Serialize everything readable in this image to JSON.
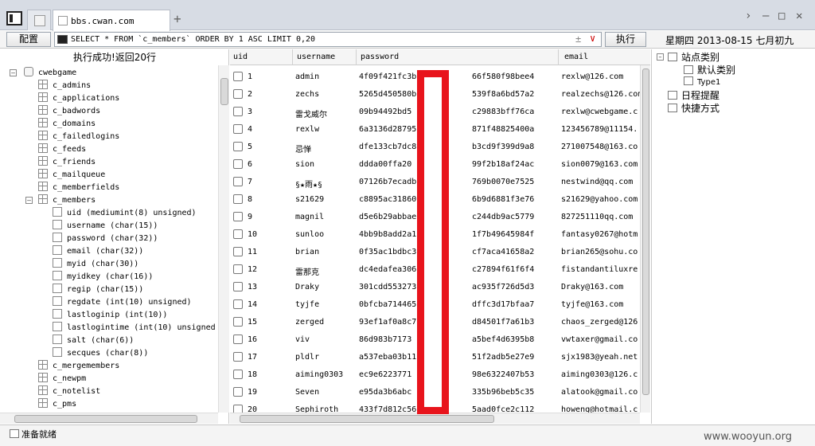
{
  "tab": {
    "title": "bbs.cwan.com",
    "add": "+"
  },
  "window": {
    "nav": "›",
    "minimize": "–",
    "maximize": "□",
    "close": "✕"
  },
  "toolbar": {
    "config_label": "配置",
    "sql_query": "SELECT * FROM `c_members` ORDER BY 1 ASC LIMIT 0,20",
    "plusminus": "±",
    "dropdown": "∨",
    "execute_label": "执行",
    "date": "星期四 2013-08-15 七月初九"
  },
  "result_message": "执行成功!返回20行",
  "tree": {
    "database": "cwebgame",
    "tables_before": [
      "c_admins",
      "c_applications",
      "c_badwords",
      "c_domains",
      "c_failedlogins",
      "c_feeds",
      "c_friends",
      "c_mailqueue",
      "c_memberfields"
    ],
    "expanded_table": "c_members",
    "columns": [
      "uid (mediumint(8) unsigned)",
      "username (char(15))",
      "password (char(32))",
      "email (char(32))",
      "myid (char(30))",
      "myidkey (char(16))",
      "regip (char(15))",
      "regdate (int(10) unsigned)",
      "lastloginip (int(10))",
      "lastlogintime (int(10) unsigned",
      "salt (char(6))",
      "secques (char(8))"
    ],
    "tables_after": [
      "c_mergemembers",
      "c_newpm",
      "c_notelist",
      "c_pms"
    ]
  },
  "grid": {
    "headers": [
      "uid",
      "username",
      "password",
      "email"
    ],
    "rows": [
      [
        "1",
        "admin",
        "4f09f421fc3b",
        "66f580f98bee4",
        "rexlw@126.com"
      ],
      [
        "2",
        "zechs",
        "5265d450580b",
        "539f8a6bd57a2",
        "realzechs@126.com"
      ],
      [
        "3",
        "雷戈威尔",
        "09b94492bd5",
        "c29883bff76ca",
        "rexlw@cwebgame.c"
      ],
      [
        "4",
        "rexlw",
        "6a3136d28795",
        "871f48825400a",
        "123456789@11154."
      ],
      [
        "5",
        "忌惮",
        "dfe133cb7dc8",
        "b3cd9f399d9a8",
        "271007548@163.co"
      ],
      [
        "6",
        "sion",
        "ddda00ffa20",
        "99f2b18af24ac",
        "sion0079@163.com"
      ],
      [
        "7",
        "§★雨★§",
        "07126b7ecadb",
        "769b0070e7525",
        "nestwind@qq.com"
      ],
      [
        "8",
        "s21629",
        "c8895ac31860",
        "6b9d6881f3e76",
        "s21629@yahoo.com"
      ],
      [
        "9",
        "magnil",
        "d5e6b29abbae",
        "c244db9ac5779",
        "827251110qq.com"
      ],
      [
        "10",
        "sunloo",
        "4bb9b8add2a1",
        "1f7b49645984f",
        "fantasy0267@hotm"
      ],
      [
        "11",
        "brian",
        "0f35ac1bdbc3",
        "cf7aca41658a2",
        "brian265@sohu.co"
      ],
      [
        "12",
        "雷那克",
        "dc4edafea306",
        "c27894f61f6f4",
        "fistandantiluxre"
      ],
      [
        "13",
        "Draky",
        "301cdd553273",
        "ac935f726d5d3",
        "Draky@163.com"
      ],
      [
        "14",
        "tyjfe",
        "0bfcba714465",
        "dffc3d17bfaa7",
        "tyjfe@163.com"
      ],
      [
        "15",
        "zerged",
        "93ef1af0a8c7",
        "d84501f7a61b3",
        "chaos_zerged@126"
      ],
      [
        "16",
        "viv",
        "86d983b7173",
        "a5bef4d6395b8",
        "vwtaxer@gmail.co"
      ],
      [
        "17",
        "pldlr",
        "a537eba03b11",
        "51f2adb5e27e9",
        "sjx1983@yeah.net"
      ],
      [
        "18",
        "aiming0303",
        "ec9e6223771",
        "98e6322407b53",
        "aiming0303@126.c"
      ],
      [
        "19",
        "Seven",
        "e95da3b6abc",
        "335b96beb5c35",
        "alatook@gmail.co"
      ],
      [
        "20",
        "Sephiroth",
        "433f7d812c56",
        "5aad0fce2c112",
        "howeng@hotmail.c"
      ]
    ]
  },
  "right_panel": {
    "category_root": "站点类别",
    "categories": [
      "默认类别",
      "Type1"
    ],
    "schedule": "日程提醒",
    "shortcuts": "快捷方式"
  },
  "status": {
    "text": "准备就绪"
  },
  "watermark": "www.wooyun.org",
  "colors": {
    "highlight": "#e8141c"
  }
}
